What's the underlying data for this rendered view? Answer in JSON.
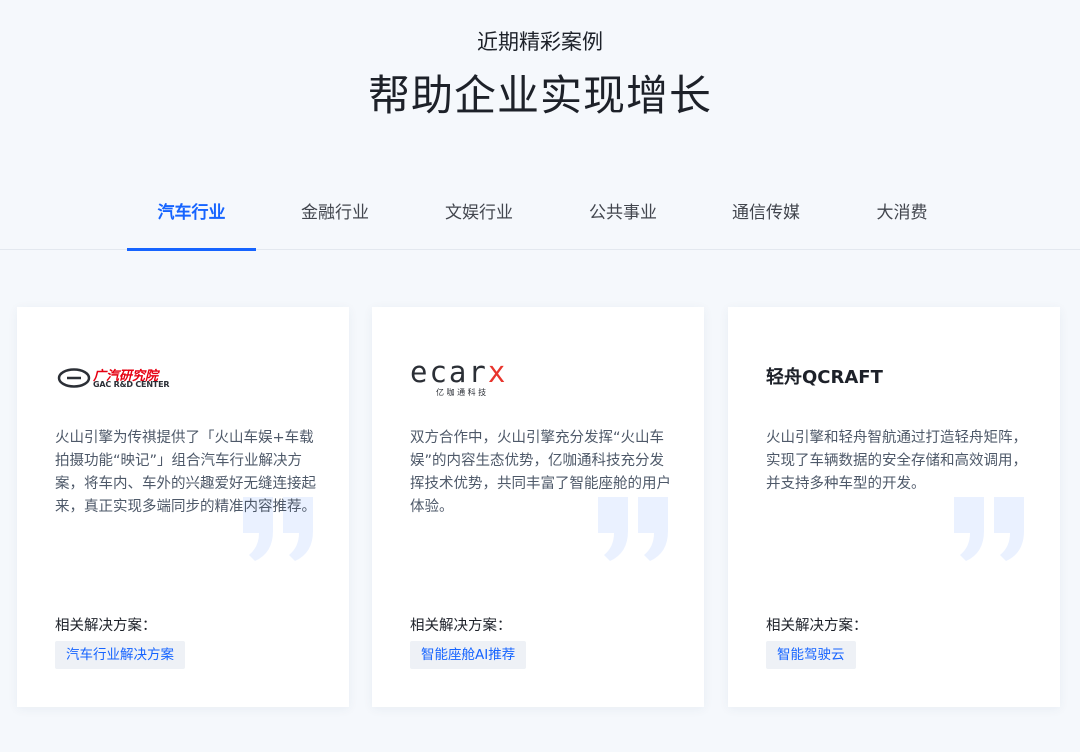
{
  "header": {
    "subtitle": "近期精彩案例",
    "title": "帮助企业实现增长"
  },
  "tabs": [
    {
      "label": "汽车行业",
      "active": true
    },
    {
      "label": "金融行业",
      "active": false
    },
    {
      "label": "文娱行业",
      "active": false
    },
    {
      "label": "公共事业",
      "active": false
    },
    {
      "label": "通信传媒",
      "active": false
    },
    {
      "label": "大消费",
      "active": false
    }
  ],
  "cards": [
    {
      "logo_text": "广汽研究院",
      "logo_sub": "GAC R&D CENTER",
      "description": "火山引擎为传祺提供了「火山车娱+车载拍摄功能“映记”」组合汽车行业解决方案，将车内、车外的兴趣爱好无缝连接起来，真正实现多端同步的精准内容推荐。",
      "related_label": "相关解决方案：",
      "tag": "汽车行业解决方案"
    },
    {
      "logo_text": "ecarx",
      "logo_sub": "亿 咖 通 科 技",
      "description": "双方合作中，火山引擎充分发挥“火山车娱”的内容生态优势，亿咖通科技充分发挥技术优势，共同丰富了智能座舱的用户体验。",
      "related_label": "相关解决方案：",
      "tag": "智能座舱AI推荐"
    },
    {
      "logo_text": "轻舟QCRAFT",
      "logo_sub": "",
      "description": "火山引擎和轻舟智航通过打造轻舟矩阵，实现了车辆数据的安全存储和高效调用，并支持多种车型的开发。",
      "related_label": "相关解决方案：",
      "tag": "智能驾驶云"
    }
  ],
  "colors": {
    "accent": "#1664ff",
    "background": "#f5f8fc",
    "tag_bg": "#eef1f6",
    "gac_red": "#e60012",
    "ecarx_dark": "#2b2f36",
    "ecarx_red": "#e8342c",
    "quote_mark": "#eaf1ff"
  },
  "icons": {
    "gac": "gac-oval-logo-icon",
    "quote": "quote-mark-icon"
  }
}
